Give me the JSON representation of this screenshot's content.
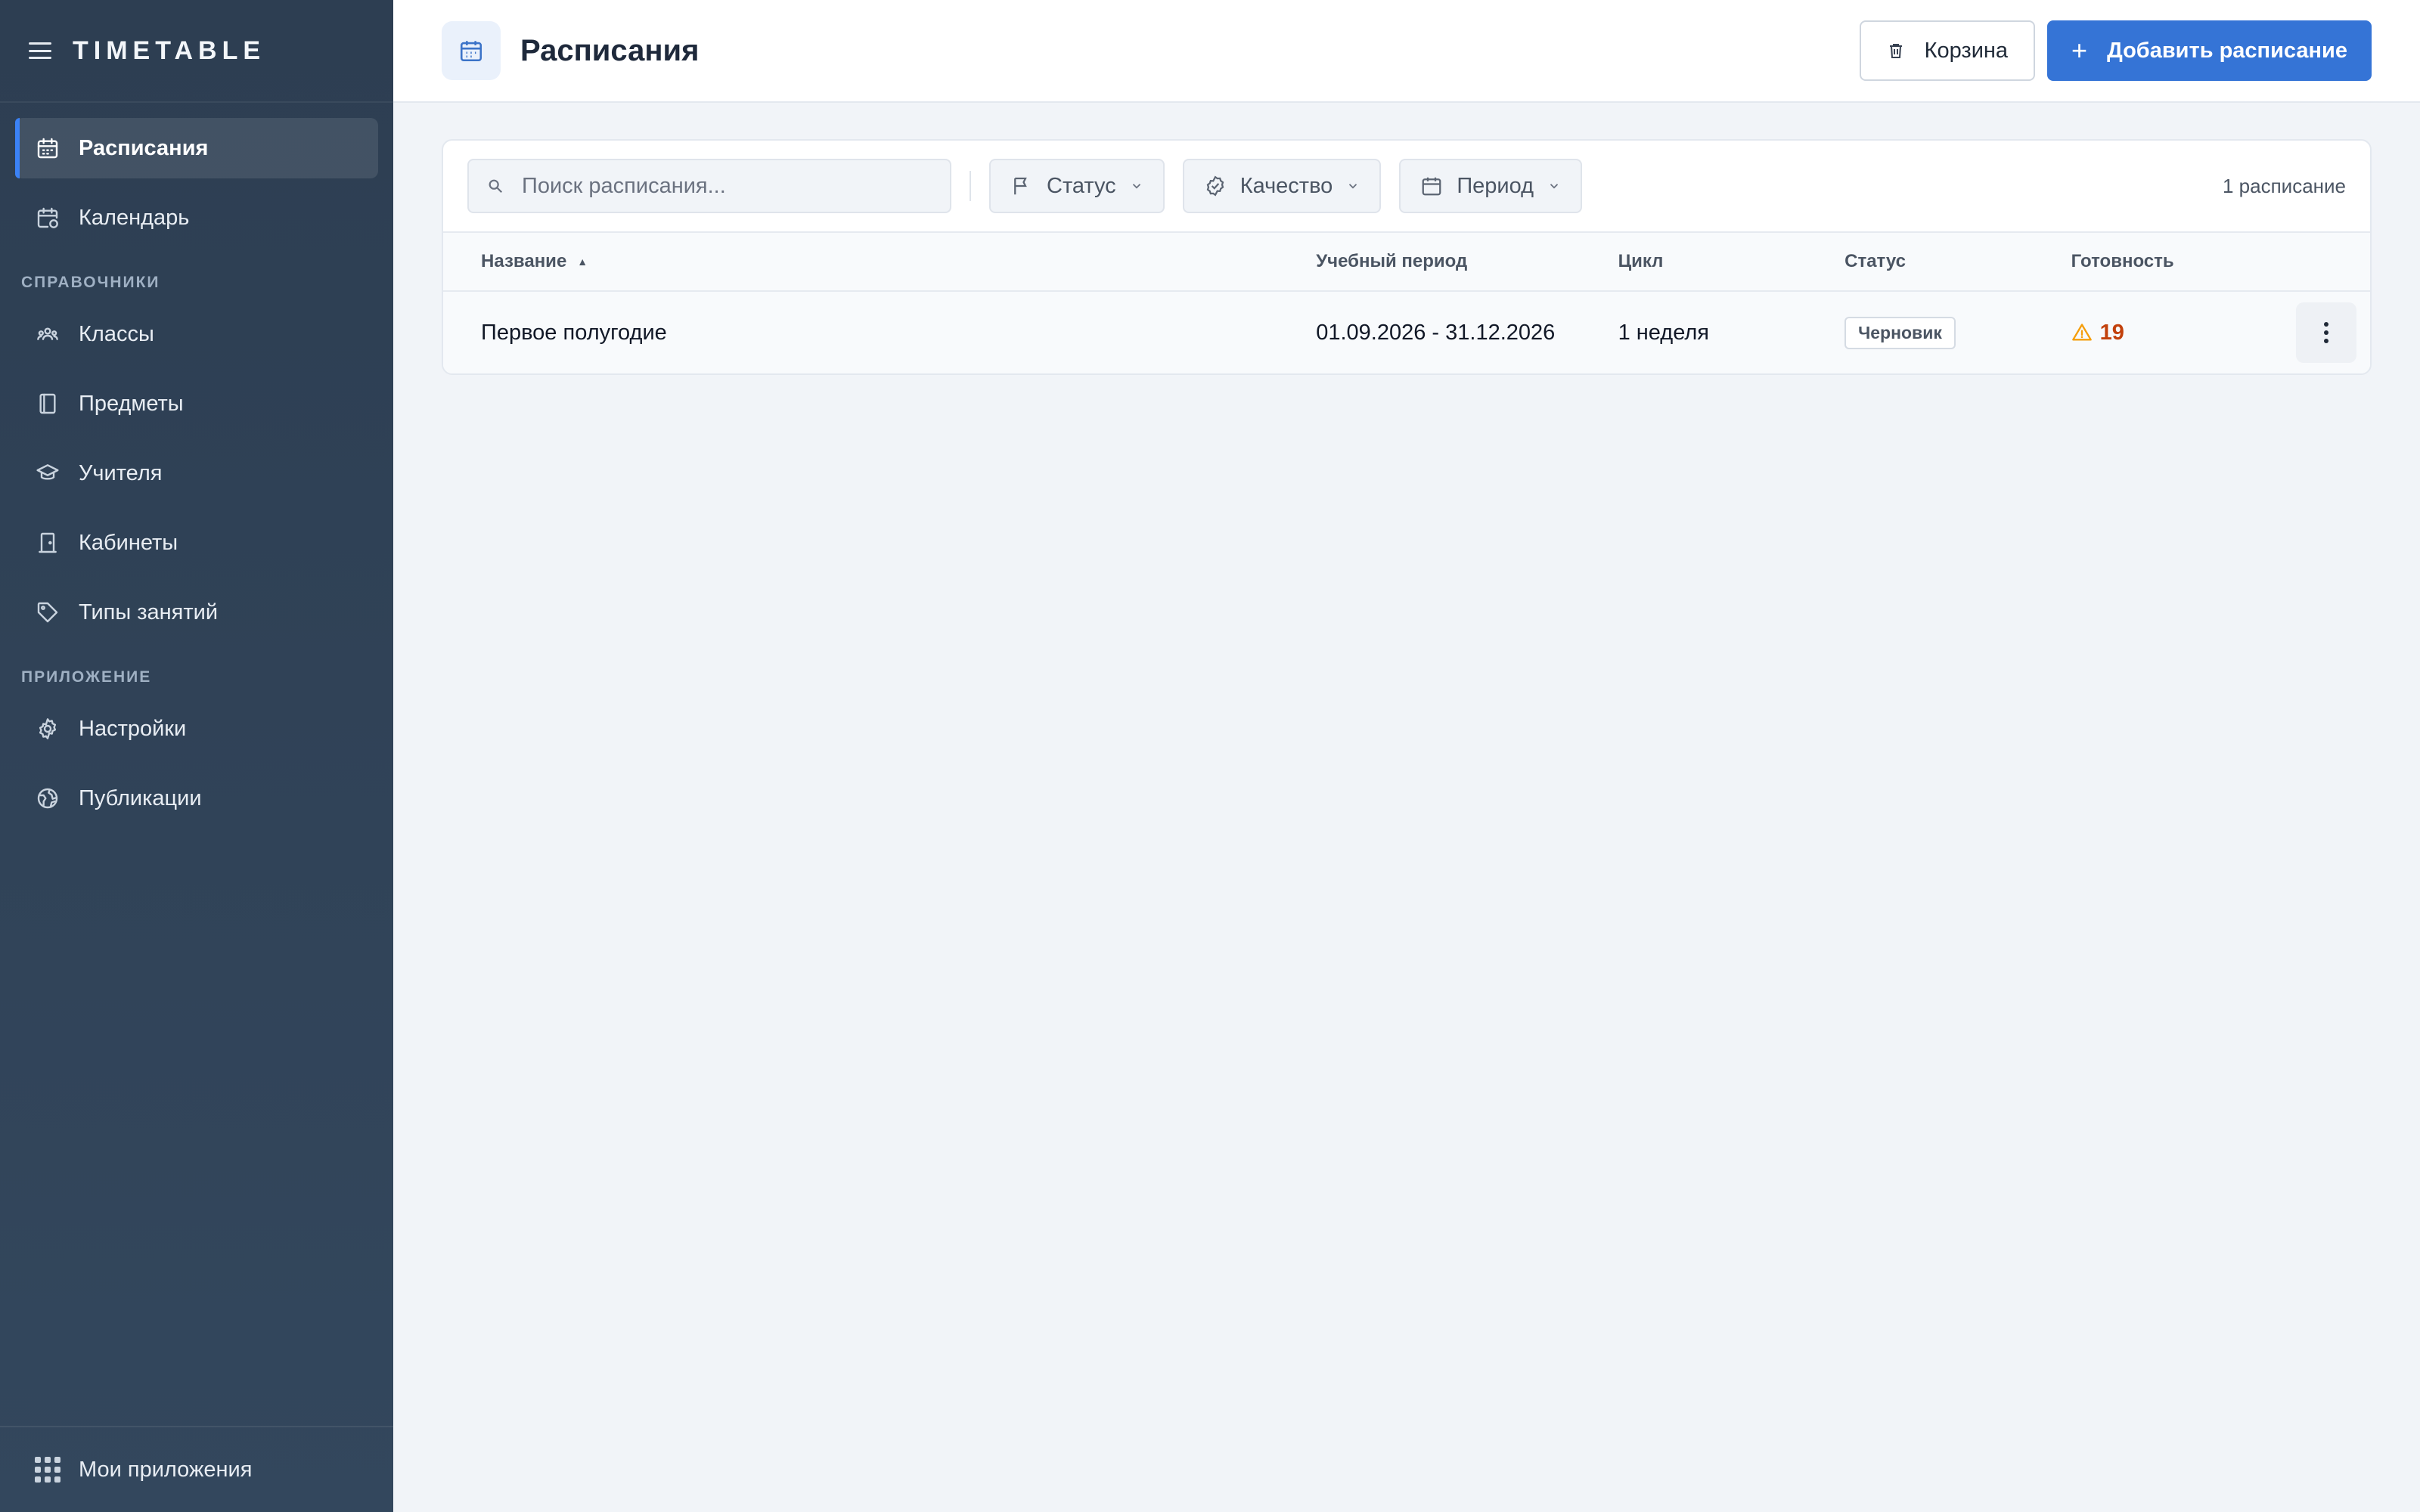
{
  "app": {
    "brand": "TIMETABLE"
  },
  "sidebar": {
    "items": [
      {
        "label": "Расписания",
        "icon": "calendar-icon",
        "active": true
      },
      {
        "label": "Календарь",
        "icon": "calendar-clock-icon"
      }
    ],
    "sections": [
      {
        "title": "СПРАВОЧНИКИ",
        "items": [
          {
            "label": "Классы",
            "icon": "users-icon"
          },
          {
            "label": "Предметы",
            "icon": "book-icon"
          },
          {
            "label": "Учителя",
            "icon": "graduation-cap-icon"
          },
          {
            "label": "Кабинеты",
            "icon": "door-icon"
          },
          {
            "label": "Типы занятий",
            "icon": "tag-icon"
          }
        ]
      },
      {
        "title": "ПРИЛОЖЕНИЕ",
        "items": [
          {
            "label": "Настройки",
            "icon": "gear-icon"
          },
          {
            "label": "Публикации",
            "icon": "globe-icon"
          }
        ]
      }
    ],
    "footer": {
      "label": "Мои приложения",
      "icon": "apps-grid-icon"
    }
  },
  "header": {
    "title": "Расписания",
    "trash_label": "Корзина",
    "add_label": "Добавить расписание"
  },
  "toolbar": {
    "search_placeholder": "Поиск расписания...",
    "filters": [
      {
        "label": "Статус",
        "icon": "flag-icon"
      },
      {
        "label": "Качество",
        "icon": "badge-check-icon"
      },
      {
        "label": "Период",
        "icon": "calendar-icon"
      }
    ],
    "count": "1 расписание"
  },
  "table": {
    "columns": [
      "Название",
      "Учебный период",
      "Цикл",
      "Статус",
      "Готовность"
    ],
    "rows": [
      {
        "name": "Первое полугодие",
        "period": "01.09.2026 - 31.12.2026",
        "cycle": "1 неделя",
        "status": "Черновик",
        "readiness": "19"
      }
    ]
  },
  "colors": {
    "sidebar": "#2d3e52",
    "accent": "#3574d6",
    "warning": "#c2410c"
  }
}
